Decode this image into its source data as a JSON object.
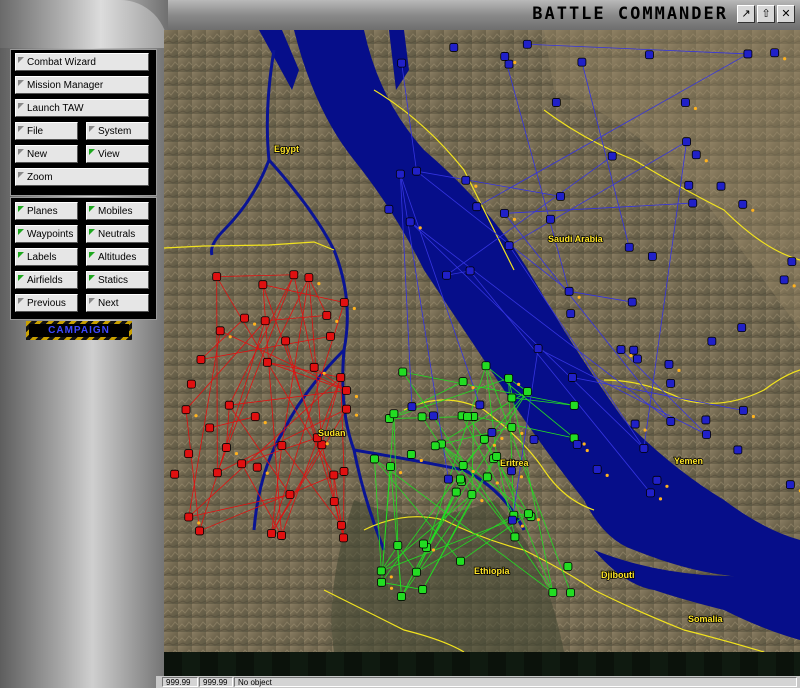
{
  "app": {
    "title": "BATTLE COMMANDER"
  },
  "window_buttons": [
    {
      "icon": "pin-icon",
      "glyph": "↗"
    },
    {
      "icon": "restore-icon",
      "glyph": "⇧"
    },
    {
      "icon": "close-icon",
      "glyph": "✕"
    }
  ],
  "menu": {
    "combat_wizard": "Combat Wizard",
    "mission_manager": "Mission Manager",
    "launch_taw": "Launch TAW",
    "file": "File",
    "system": "System",
    "new": "New",
    "view": "View",
    "zoom": "Zoom"
  },
  "filters": {
    "planes": "Planes",
    "mobiles": "Mobiles",
    "waypoints": "Waypoints",
    "neutrals": "Neutrals",
    "labels": "Labels",
    "altitudes": "Altitudes",
    "airfields": "Airfields",
    "statics": "Statics",
    "previous": "Previous",
    "next": "Next"
  },
  "campaign_label": "CAMPAIGN",
  "map": {
    "labels": {
      "egypt": "Egypt",
      "saudi_arabia": "Saudi Arabia",
      "sudan": "Sudan",
      "eritrea": "Eritrea",
      "yemen": "Yemen",
      "ethiopia": "Ethiopia",
      "djibouti": "Djibouti",
      "somalia": "Somalia"
    },
    "colors": {
      "land": "#7c6e55",
      "sea": "#060e8a",
      "border": "#f2e31e",
      "red_force": "#e01010",
      "green_force": "#22dd22",
      "blue_force": "#2020c8"
    }
  },
  "status": {
    "coord_x": "999.99",
    "coord_y": "999.99",
    "object": "No object"
  }
}
